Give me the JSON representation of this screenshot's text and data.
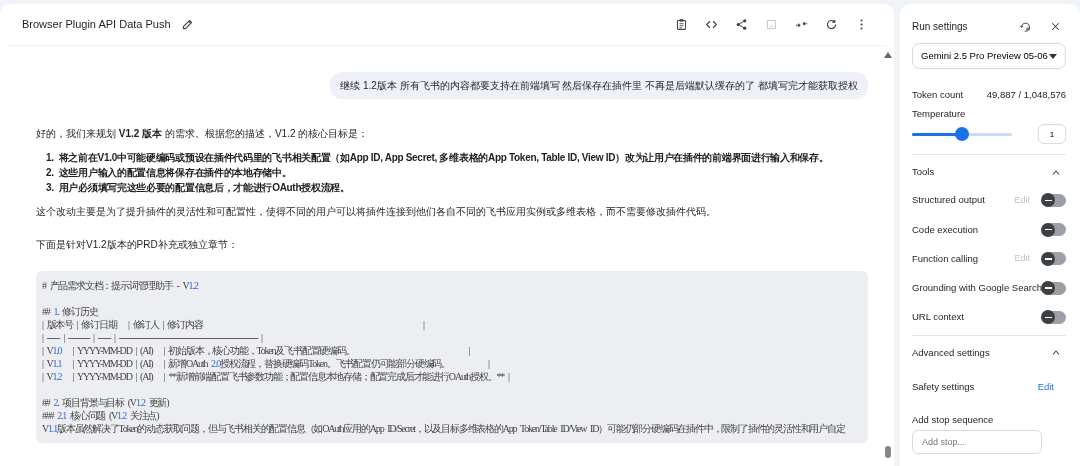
{
  "header": {
    "title": "Browser Plugin API Data Push"
  },
  "user_message": "继续 1.2版本 所有飞书的内容都要支持在前端填写 然后保存在插件里 不再是后端默认缓存的了 都填写完才能获取授权",
  "reply": {
    "intro": "好的，我们来规划 **V1.2 版本** 的需求。根据您的描述，V1.2 的核心目标是：",
    "goals": [
      {
        "marker": "1.",
        "text": "将之前在V1.0中可能硬编码或预设在插件代码里的飞书相关配置（如App ID, App Secret, 多维表格的App Token, Table ID, View ID）改为让用户在插件的前端界面进行输入和保存。"
      },
      {
        "marker": "2.",
        "text": "这些用户输入的配置信息将保存在插件的本地存储中。"
      },
      {
        "marker": "3.",
        "text": "用户必须填写完这些必要的配置信息后，才能进行OAuth授权流程。"
      }
    ],
    "paragraphs": [
      "这个改动主要是为了提升插件的灵活性和可配置性，使得不同的用户可以将插件连接到他们各自不同的飞书应用实例或多维表格，而不需要修改插件代码。",
      "下面是针对V1.2版本的PRD补充或独立章节："
    ],
    "code_blocks": [
      [
        "# 产品需求文档：提示词管理助手 - V1.2"
      ],
      [
        "## 1. 修订历史",
        "| 版本号 | 修订日期   | 修订人 | 修订内容                                                          |",
        "| ------ | ---------- | ------ | ----------------------------------------------------------------- |",
        "| V1.0   | YYYY-MM-DD | (AI)   | 初始版本，核心功能，Token及飞书配置硬编码。                              |",
        "| V1.1   | YYYY-MM-DD | (AI)   | 新增OAuth 2.0授权流程，替换硬编码Token。飞书配置仍可能部分硬编码。          |",
        "| V1.2   | YYYY-MM-DD | (AI)   | **新增前端配置飞书参数功能；配置信息本地存储；配置完成后才能进行OAuth授权。** |"
      ],
      [
        "## 2. 项目背景与目标 (V1.2 更新)",
        "### 2.1 核心问题 (V1.2 关注点)",
        "V1.1版本虽然解决了Token的动态获取问题，但与飞书相关的配置信息（如OAuth应用的App ID/Secret，以及目标多维表格的App Token/Table ID/View ID）可能仍部分硬编码在插件中，限制了插件的灵活性和用户自定"
      ]
    ]
  },
  "run_settings": {
    "title": "Run settings",
    "model": "Gemini 2.5 Pro Preview 05-06",
    "token_label": "Token count",
    "token_value": "49,887 / 1,048,576",
    "temperature_label": "Temperature",
    "temperature": {
      "level": 0.5,
      "value": "1"
    },
    "tools_title": "Tools",
    "tools_expanded": true,
    "tools": [
      {
        "label": "Structured output",
        "edit": "Edit",
        "on": false
      },
      {
        "label": "Code execution",
        "on": false
      },
      {
        "label": "Function calling",
        "edit": "Edit",
        "on": false
      },
      {
        "label": "Grounding with Google Search",
        "on": false
      },
      {
        "label": "URL context",
        "on": false
      }
    ],
    "advanced_title": "Advanced settings",
    "advanced_expanded": true,
    "safety_label": "Safety settings",
    "safety_edit": "Edit",
    "stop_label": "Add stop sequence",
    "stop_placeholder": "Add stop..."
  }
}
